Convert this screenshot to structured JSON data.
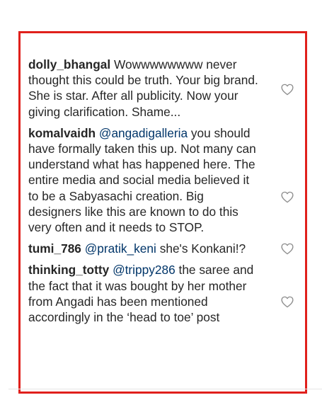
{
  "comments": [
    {
      "username": "dolly_bhangal",
      "mention": "",
      "text": "Wowwwwwwww never thought this could be truth. Your big brand. She is star. After all publicity. Now your giving clarification. Shame..."
    },
    {
      "username": "komalvaidh",
      "mention": "@angadigalleria",
      "text": "you should have formally taken this up. Not many can understand what has happened here. The entire media and social media believed it to be a Sabyasachi creation. Big designers like this are known to do this very often and it needs to STOP."
    },
    {
      "username": "tumi_786",
      "mention": "@pratik_keni",
      "text": "she's Konkani!?"
    },
    {
      "username": "thinking_totty",
      "mention": "@trippy286",
      "text": "the saree and the fact that it was bought by her mother from Angadi has been mentioned accordingly in the ‘head to toe’ post"
    }
  ],
  "icons": {
    "like": "heart-outline-icon"
  },
  "colors": {
    "highlight_border": "#e0201c",
    "mention": "#003569",
    "text": "#262626",
    "icon": "#8e8e8e"
  }
}
